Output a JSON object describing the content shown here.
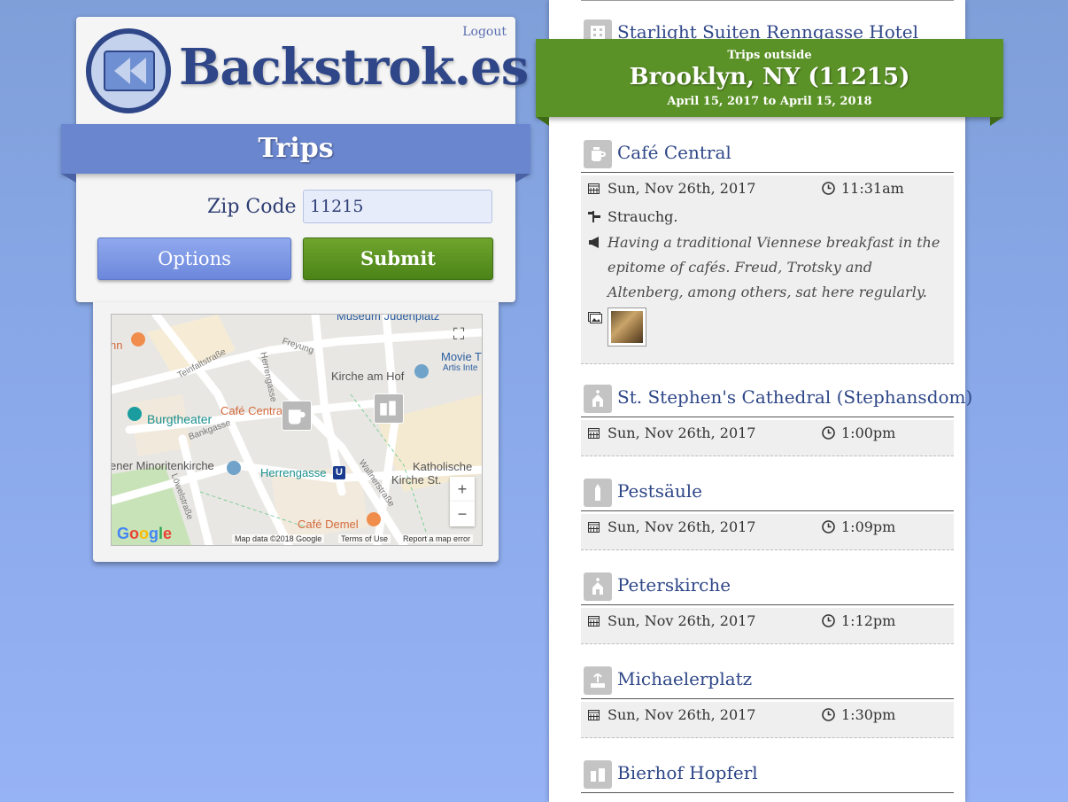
{
  "header": {
    "logout": "Logout",
    "brand": "Backstrok.es",
    "trips_title": "Trips"
  },
  "form": {
    "zip_label": "Zip Code",
    "zip_value": "11215",
    "options_label": "Options",
    "submit_label": "Submit"
  },
  "map": {
    "labels": {
      "museum": "Museum Judenplatz",
      "teinfalt": "Teinfaltstraße",
      "freyung": "Freyung",
      "herrengasse_street": "Herrengasse",
      "kirche_am_hof": "Kirche am Hof",
      "movie": "Movie T",
      "artis": "Artis Inte",
      "burgtheater": "Burgtheater",
      "cafe_central": "Café Central",
      "bankgasse": "Bankgasse",
      "minoritenkirche": "ener Minoritenkirche",
      "herrengasse_station": "Herrengasse",
      "katholische": "Katholische",
      "kirche_st": "Kirche St.",
      "wallnerstrasse": "Wallnerstraße",
      "loewel": "Löwelstraße",
      "cafe_demel": "Café Demel",
      "inn": "nn",
      "metro": "U"
    },
    "attribution": {
      "google": "Google",
      "map_data": "Map data ©2018 Google",
      "terms": "Terms of Use",
      "report": "Report a map error"
    },
    "zoom_in": "+",
    "zoom_out": "−"
  },
  "banner": {
    "prefix": "Trips outside",
    "location": "Brooklyn, NY (11215)",
    "range": "April 15, 2017 to April 15, 2018"
  },
  "places": [
    {
      "title": "Starlight Suiten Renngasse Hotel",
      "icon": "hotel-icon"
    },
    {
      "title": "Café Central",
      "icon": "coffee-icon",
      "date": "Sun, Nov 26th, 2017",
      "time": "11:31am",
      "author": "Strauchg.",
      "note": "Having a traditional Viennese breakfast in the epitome of cafés. Freud, Trotsky and Altenberg, among others, sat here regularly."
    },
    {
      "title": "St. Stephen's Cathedral (Stephansdom)",
      "icon": "church-icon",
      "date": "Sun, Nov 26th, 2017",
      "time": "1:00pm"
    },
    {
      "title": "Pestsäule",
      "icon": "monument-icon",
      "date": "Sun, Nov 26th, 2017",
      "time": "1:09pm"
    },
    {
      "title": "Peterskirche",
      "icon": "church-icon",
      "date": "Sun, Nov 26th, 2017",
      "time": "1:12pm"
    },
    {
      "title": "Michaelerplatz",
      "icon": "fountain-icon",
      "date": "Sun, Nov 26th, 2017",
      "time": "1:30pm"
    },
    {
      "title": "Bierhof Hopferl",
      "icon": "beer-icon"
    }
  ],
  "colors": {
    "brand_blue": "#2f4788",
    "trips_bar": "#6a86cf",
    "banner_green": "#5b9227",
    "submit_green": "#5a9322"
  }
}
